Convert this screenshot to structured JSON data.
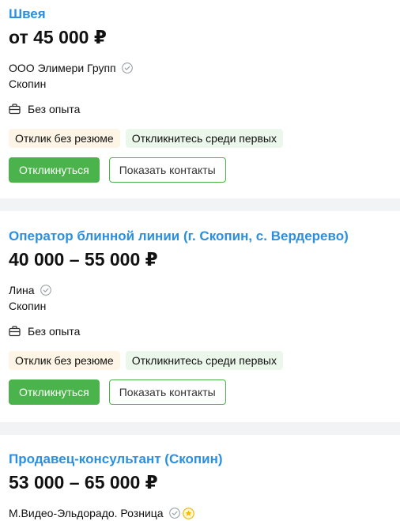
{
  "vacancies": [
    {
      "title": "Швея",
      "salary": "от 45 000 ₽",
      "company": "ООО Элимери Групп",
      "city": "Скопин",
      "experience": "Без опыта",
      "tags": [
        "Отклик без резюме",
        "Откликнитесь среди первых"
      ],
      "respond_label": "Откликнуться",
      "contacts_label": "Показать контакты"
    },
    {
      "title": "Оператор блинной линии (г. Скопин, с. Вердерево)",
      "salary": "40 000 – 55 000 ₽",
      "company": "Лина",
      "city": "Скопин",
      "experience": "Без опыта",
      "tags": [
        "Отклик без резюме",
        "Откликнитесь среди первых"
      ],
      "respond_label": "Откликнуться",
      "contacts_label": "Показать контакты"
    },
    {
      "title": "Продавец-консультант (Скопин)",
      "salary": "53 000 – 65 000 ₽",
      "company": "М.Видео-Эльдорадо. Розница",
      "icons": [
        "check-circle-icon",
        "gold-star-badge-icon"
      ]
    }
  ],
  "colors": {
    "title_link": "#2b8fe0",
    "primary_green": "#4bb34b",
    "tag_orange_bg": "#fef5e6",
    "tag_green_bg": "#ecf7ec",
    "page_bg": "#f2f3f5"
  }
}
